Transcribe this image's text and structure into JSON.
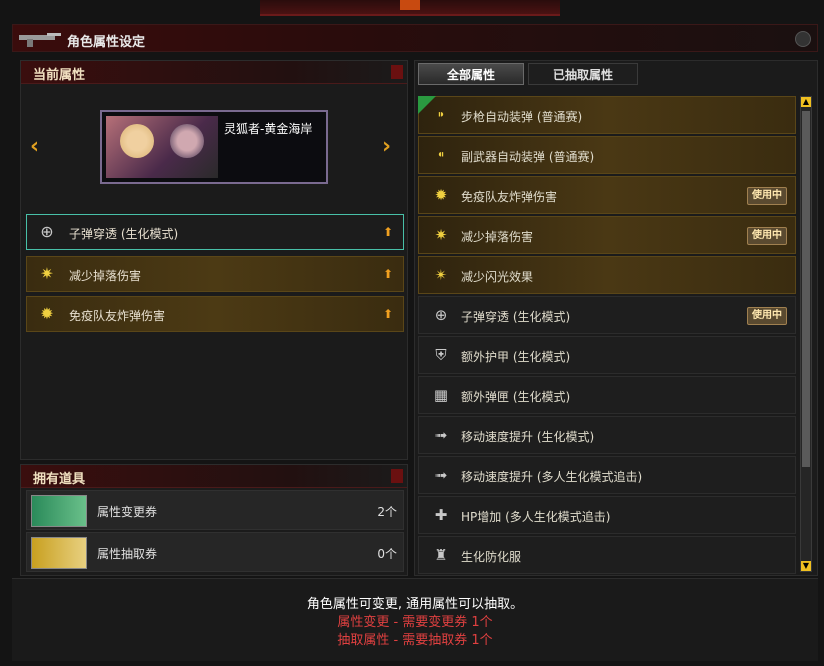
{
  "window": {
    "title": "角色属性设定"
  },
  "current": {
    "header": "当前属性",
    "character_name": "灵狐者-黄金海岸",
    "attributes": [
      {
        "label": "子弹穿透 (生化模式)",
        "icon": "crosshair-icon"
      },
      {
        "label": "减少掉落伤害",
        "icon": "spark-icon"
      },
      {
        "label": "免疫队友炸弹伤害",
        "icon": "explosion-icon"
      }
    ]
  },
  "items": {
    "header": "拥有道具",
    "list": [
      {
        "label": "属性变更券",
        "count": "2个"
      },
      {
        "label": "属性抽取券",
        "count": "0个"
      }
    ]
  },
  "tabs": {
    "all": "全部属性",
    "extracted": "已抽取属性"
  },
  "attr_list": [
    {
      "label": "步枪自动装弹 (普通赛)",
      "style": "gold",
      "badge": "",
      "icon": "rifle-icon",
      "new": true
    },
    {
      "label": "副武器自动装弹 (普通赛)",
      "style": "gold",
      "badge": "",
      "icon": "pistol-icon"
    },
    {
      "label": "免疫队友炸弹伤害",
      "style": "gold",
      "badge": "使用中",
      "icon": "explosion-icon"
    },
    {
      "label": "减少掉落伤害",
      "style": "gold",
      "badge": "使用中",
      "icon": "spark-icon"
    },
    {
      "label": "减少闪光效果",
      "style": "gold",
      "badge": "",
      "icon": "flash-icon"
    },
    {
      "label": "子弹穿透 (生化模式)",
      "style": "dark",
      "badge": "使用中",
      "icon": "crosshair-icon"
    },
    {
      "label": "额外护甲 (生化模式)",
      "style": "dark",
      "badge": "",
      "icon": "armor-icon"
    },
    {
      "label": "额外弹匣 (生化模式)",
      "style": "dark",
      "badge": "",
      "icon": "magazine-icon"
    },
    {
      "label": "移动速度提升 (生化模式)",
      "style": "dark",
      "badge": "",
      "icon": "speed-icon"
    },
    {
      "label": "移动速度提升 (多人生化模式追击)",
      "style": "dark",
      "badge": "",
      "icon": "speed-icon"
    },
    {
      "label": "HP增加 (多人生化模式追击)",
      "style": "dark",
      "badge": "",
      "icon": "hp-icon"
    },
    {
      "label": "生化防化服",
      "style": "dark",
      "badge": "",
      "icon": "suit-icon"
    }
  ],
  "footer": {
    "line1": "角色属性可变更, 通用属性可以抽取。",
    "line2": "属性变更 - 需要变更券 1个",
    "line3": "抽取属性 - 需要抽取券 1个"
  },
  "colors": {
    "accent": "#e0a020",
    "selected_border": "#48c0a8",
    "warning": "#e04040"
  }
}
